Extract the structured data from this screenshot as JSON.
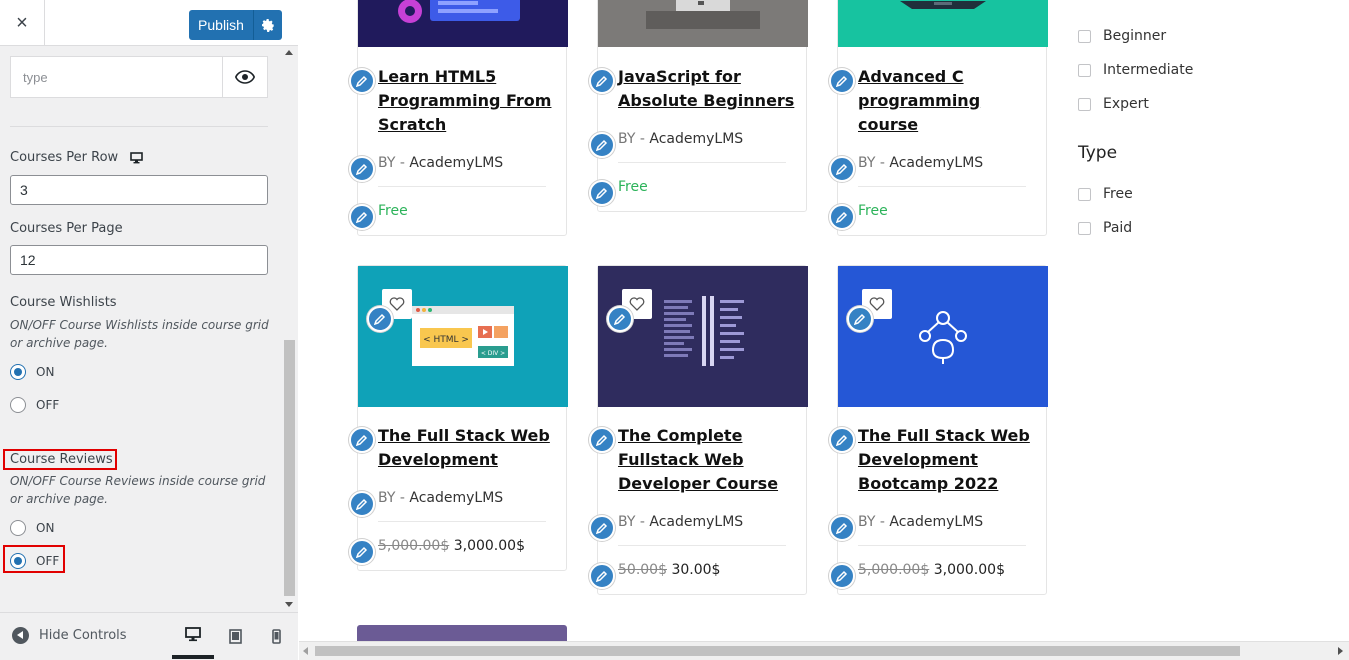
{
  "header": {
    "close_label": "×",
    "publish_label": "Publish"
  },
  "controls": {
    "type_placeholder": "type",
    "courses_per_row": {
      "label": "Courses Per Row",
      "value": "3"
    },
    "courses_per_page": {
      "label": "Courses Per Page",
      "value": "12"
    },
    "course_wishlists": {
      "label": "Course Wishlists",
      "description": "ON/OFF Course Wishlists inside course grid or archive page.",
      "options": [
        "ON",
        "OFF"
      ],
      "selected": "ON"
    },
    "course_reviews": {
      "label": "Course Reviews",
      "description": "ON/OFF Course Reviews inside course grid or archive page.",
      "options": [
        "ON",
        "OFF"
      ],
      "selected": "OFF"
    }
  },
  "footer": {
    "hide_controls_label": "Hide Controls"
  },
  "courses": [
    {
      "title": "Learn HTML5 Programming From Scratch",
      "by": "BY -",
      "author": "AcademyLMS",
      "price_free": "Free"
    },
    {
      "title": "JavaScript for Absolute Beginners",
      "by": "BY -",
      "author": "AcademyLMS",
      "price_free": "Free"
    },
    {
      "title": "Advanced C programming course",
      "by": "BY -",
      "author": "AcademyLMS",
      "price_free": "Free"
    },
    {
      "title": "The Full Stack Web Development",
      "by": "BY -",
      "author": "AcademyLMS",
      "old_price": "5,000.00$",
      "price": "3,000.00$"
    },
    {
      "title": "The Complete Fullstack Web Developer Course",
      "by": "BY -",
      "author": "AcademyLMS",
      "old_price": "50.00$",
      "price": "30.00$"
    },
    {
      "title": "The Full Stack Web Development Bootcamp 2022",
      "by": "BY -",
      "author": "AcademyLMS",
      "old_price": "5,000.00$",
      "price": "3,000.00$"
    }
  ],
  "thumbnails": {
    "html_tag": "< HTML >",
    "div_tag": "< DIV >"
  },
  "filters": {
    "levels": [
      "Beginner",
      "Intermediate",
      "Expert"
    ],
    "type_title": "Type",
    "types": [
      "Free",
      "Paid"
    ]
  },
  "colors": {
    "accent": "#2271b1",
    "free_green": "#2cb35a",
    "highlight_red": "#e10000"
  }
}
